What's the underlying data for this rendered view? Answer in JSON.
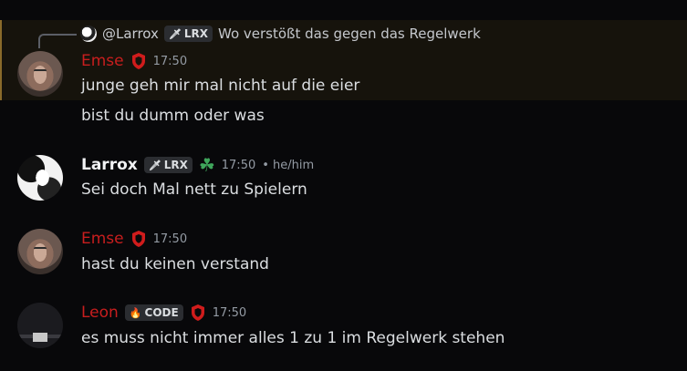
{
  "reply": {
    "mention": "@Larrox",
    "badge": "LRX",
    "text": "Wo verstößt das gegen das Regelwerk"
  },
  "messages": [
    {
      "author": "Emse",
      "time": "17:50",
      "lines": [
        "junge geh mir mal nicht auf die eier",
        "bist du dumm oder was"
      ]
    },
    {
      "author": "Larrox",
      "badge": "LRX",
      "time": "17:50",
      "pronouns": "• he/him",
      "lines": [
        "Sei doch Mal nett zu Spielern"
      ]
    },
    {
      "author": "Emse",
      "time": "17:50",
      "lines": [
        "hast du keinen verstand"
      ]
    },
    {
      "author": "Leon",
      "badge": "CODE",
      "time": "17:50",
      "lines": [
        "es muss nicht immer alles 1 zu 1 im Regelwerk stehen"
      ]
    }
  ],
  "colors": {
    "background": "#08080a",
    "role_red": "#c81e1e",
    "highlight": "#16130c",
    "clover": "#3fa55b"
  },
  "icons": {
    "role_shield": "shield-icon",
    "badge_sword": "sword-icon",
    "badge_flame": "flame-icon",
    "clover": "clover-icon"
  }
}
